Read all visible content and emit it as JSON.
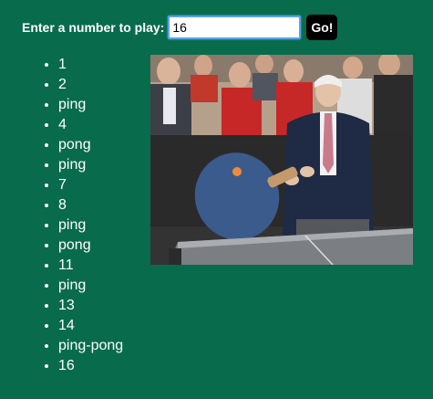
{
  "form": {
    "prompt_label": "Enter a number to play:",
    "input_value": "16",
    "go_label": "Go!"
  },
  "results": [
    "1",
    "2",
    "ping",
    "4",
    "pong",
    "ping",
    "7",
    "8",
    "ping",
    "pong",
    "11",
    "ping",
    "13",
    "14",
    "ping-pong",
    "16"
  ],
  "photo": {
    "description_icon": "ping-pong-player-photo",
    "colors": {
      "table": "#6f7377",
      "paddle": "#3a5a8c",
      "ball": "#f08a3c",
      "crowd_bg": "#b8a99a",
      "jacket": "#1f2a44"
    }
  }
}
